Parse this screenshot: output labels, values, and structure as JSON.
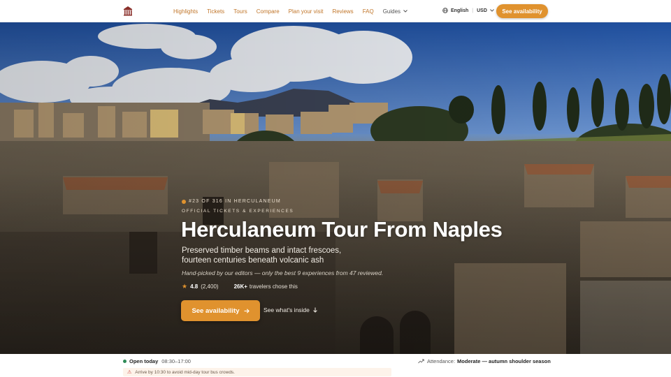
{
  "nav": {
    "links": [
      "Highlights",
      "Tickets",
      "Tours",
      "Compare",
      "Plan your visit",
      "Reviews",
      "FAQ"
    ],
    "guides_label": "Guides",
    "language": "English",
    "currency": "USD",
    "cta_label": "See availability"
  },
  "hero": {
    "rank_text": "#23 OF 316 IN HERCULANEUM",
    "kicker": "OFFICIAL TICKETS & EXPERIENCES",
    "title": "Herculaneum Tour From Naples",
    "subtitle_line1": "Preserved timber beams and intact frescoes,",
    "subtitle_line2": "fourteen centuries beneath volcanic ash",
    "editor_note": "Hand-picked by our editors — only the best 9 experiences from 47 reviewed.",
    "rating": "4.8",
    "review_count": "(2,400)",
    "travelers_count": "26K+",
    "travelers_label": "travelers chose this",
    "cta_label": "See availability",
    "secondary_link": "See what's inside"
  },
  "status": {
    "open_label": "Open today",
    "hours": "08:30–17:00",
    "attendance_label": "Attendance:",
    "attendance_value": "Moderate — autumn shoulder season",
    "alert_text": "Arrive by 10:30 to avoid mid-day tour bus crowds."
  },
  "colors": {
    "accent": "#e0922e",
    "nav_link": "#c1762a",
    "open_dot": "#2e8b57",
    "alert_bg": "#fdf3ea"
  },
  "icons": [
    "logo-icon",
    "chevron-down-icon",
    "globe-icon",
    "star-icon",
    "arrow-right-icon",
    "arrow-down-icon",
    "trend-icon",
    "warning-icon"
  ]
}
